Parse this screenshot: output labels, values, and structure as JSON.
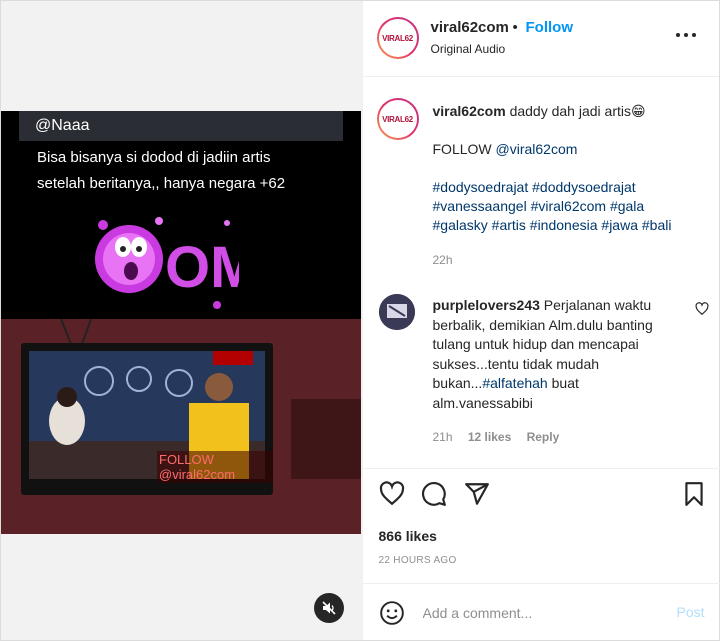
{
  "media": {
    "overlay_handle": "@Naaa",
    "overlay_line1": "Bisa bisanya si dodod di jadiin artis",
    "overlay_line2": "setelah beritanya,, hanya negara +62",
    "omg_text": "OMG",
    "tv_watermark": "FOLLOW @viral62com",
    "mute_icon": "speaker-muted-icon"
  },
  "header": {
    "avatar_logo": "VIRAL62",
    "username": "viral62com",
    "separator": "•",
    "follow_label": "Follow",
    "audio": "Original Audio",
    "more_icon": "more-options-icon"
  },
  "caption": {
    "avatar_logo": "VIRAL62",
    "username": "viral62com",
    "text": "daddy dah jadi artis",
    "emoji": "😁",
    "follow_prefix": "FOLLOW",
    "follow_mention": "@viral62com",
    "hashtags": [
      "#dodysoedrajat",
      "#doddysoedrajat",
      "#vanessaangel",
      "#viral62com",
      "#gala",
      "#galasky",
      "#artis",
      "#indonesia",
      "#jawa",
      "#bali"
    ],
    "time": "22h"
  },
  "comment": {
    "username": "purplelovers243",
    "text": "Perjalanan waktu berbalik, demikian Alm.dulu banting tulang untuk hidup dan mencapai sukses...tentu tidak mudah bukan...",
    "hashtag": "#alfatehah",
    "text_after": " buat alm.vanessabibi",
    "time": "21h",
    "likes": "12 likes",
    "reply": "Reply"
  },
  "actions": {
    "like_icon": "heart-icon",
    "comment_icon": "comment-icon",
    "share_icon": "share-icon",
    "save_icon": "bookmark-icon"
  },
  "stats": {
    "likes": "866 likes",
    "time_ago": "22 HOURS AGO"
  },
  "add_comment": {
    "placeholder": "Add a comment...",
    "post_label": "Post"
  },
  "colors": {
    "accent": "#0095f6",
    "hashtag": "#00376b",
    "muted": "#8e8e8e"
  }
}
